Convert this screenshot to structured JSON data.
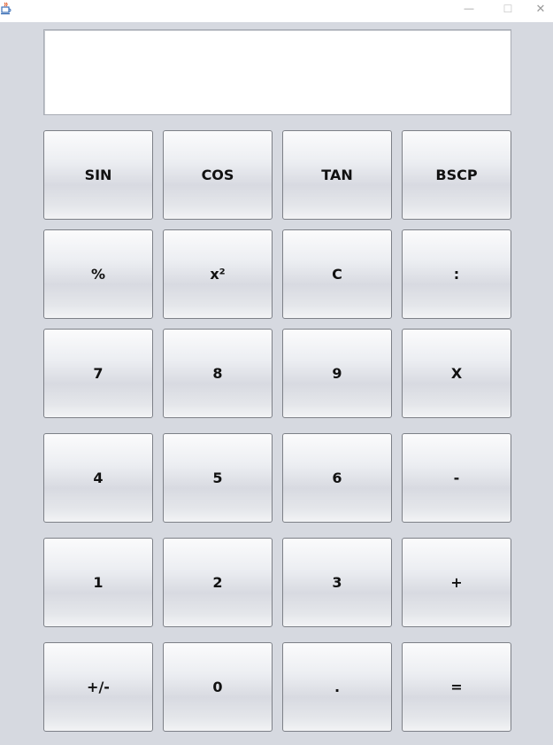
{
  "window": {
    "minimize_glyph": "—",
    "maximize_glyph": "☐",
    "close_glyph": "✕"
  },
  "display": {
    "value": ""
  },
  "buttons": {
    "sin": "SIN",
    "cos": "COS",
    "tan": "TAN",
    "bscp": "BSCP",
    "percent": "%",
    "square": "x²",
    "clear": "C",
    "divide": ":",
    "seven": "7",
    "eight": "8",
    "nine": "9",
    "multiply": "X",
    "four": "4",
    "five": "5",
    "six": "6",
    "minus": "-",
    "one": "1",
    "two": "2",
    "three": "3",
    "plus": "+",
    "negate": "+/-",
    "zero": "0",
    "decimal": ".",
    "equals": "="
  }
}
